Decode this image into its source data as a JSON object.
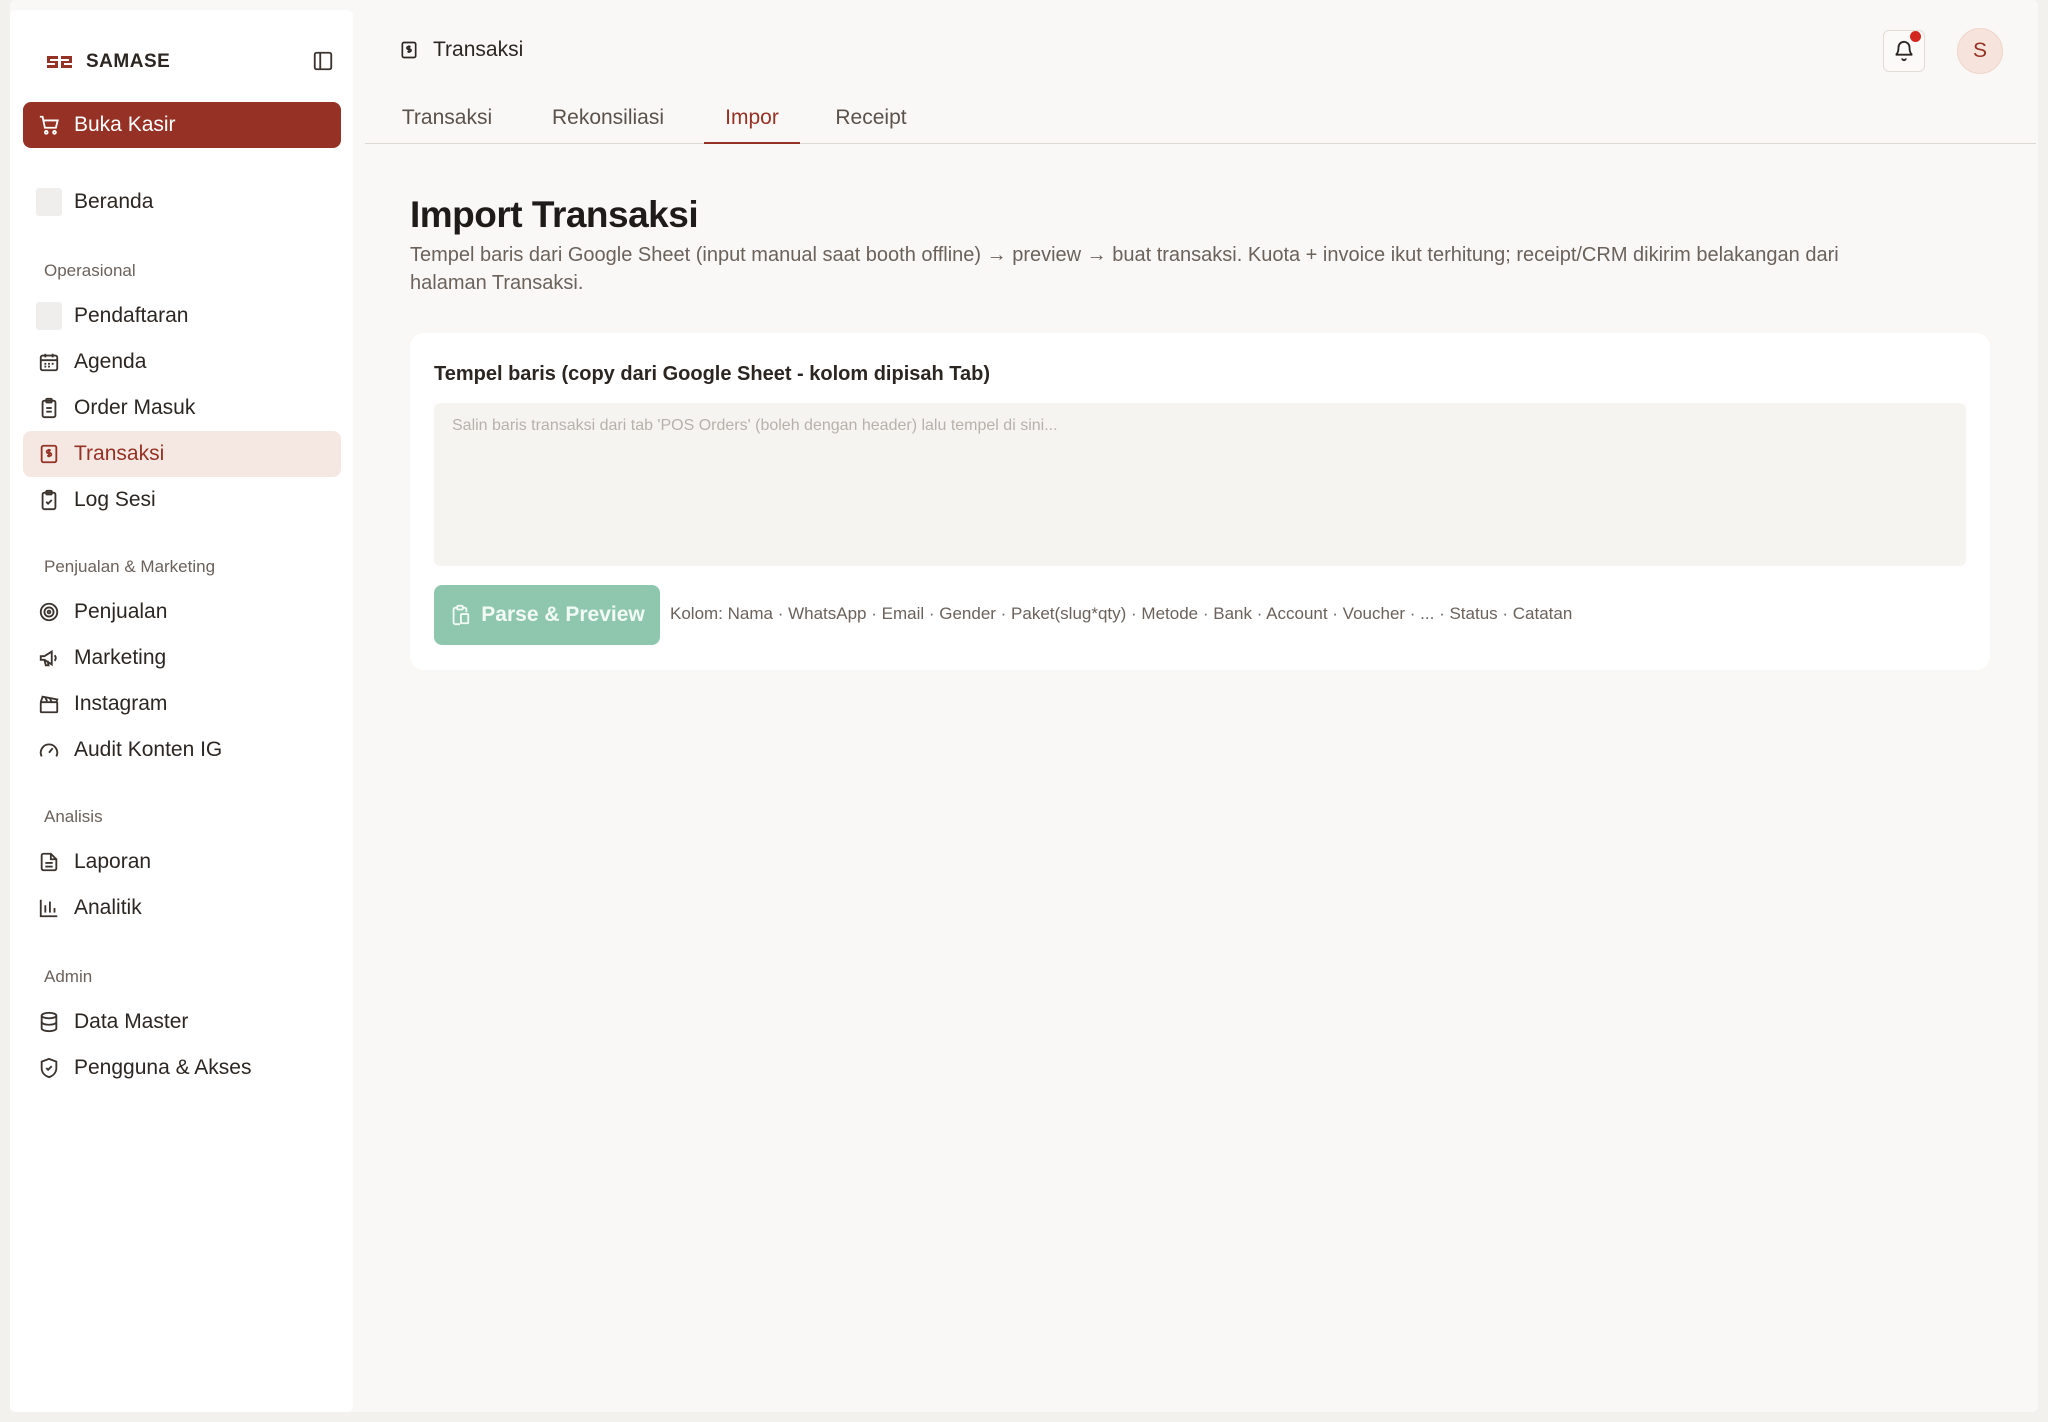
{
  "brand": {
    "name": "SAMASE"
  },
  "sidebar": {
    "cta_label": "Buka Kasir",
    "home_label": "Beranda",
    "sections": [
      {
        "label": "Operasional"
      },
      {
        "label": "Penjualan & Marketing"
      },
      {
        "label": "Analisis"
      },
      {
        "label": "Admin"
      }
    ],
    "items": [
      {
        "label": "Pendaftaran",
        "icon": "placeholder-icon"
      },
      {
        "label": "Agenda",
        "icon": "calendar-icon"
      },
      {
        "label": "Order Masuk",
        "icon": "clipboard-icon"
      },
      {
        "label": "Transaksi",
        "icon": "receipt-icon",
        "active": true
      },
      {
        "label": "Log Sesi",
        "icon": "clipboard-check-icon"
      },
      {
        "label": "Penjualan",
        "icon": "target-icon"
      },
      {
        "label": "Marketing",
        "icon": "megaphone-icon"
      },
      {
        "label": "Instagram",
        "icon": "clapperboard-icon"
      },
      {
        "label": "Audit Konten IG",
        "icon": "gauge-icon"
      },
      {
        "label": "Laporan",
        "icon": "file-text-icon"
      },
      {
        "label": "Analitik",
        "icon": "bar-chart-icon"
      },
      {
        "label": "Data Master",
        "icon": "database-icon"
      },
      {
        "label": "Pengguna & Akses",
        "icon": "shield-check-icon"
      }
    ]
  },
  "header": {
    "title": "Transaksi",
    "avatar_initial": "S"
  },
  "tabs": [
    {
      "label": "Transaksi"
    },
    {
      "label": "Rekonsiliasi"
    },
    {
      "label": "Impor",
      "active": true
    },
    {
      "label": "Receipt"
    }
  ],
  "page": {
    "title": "Import Transaksi",
    "description": "Tempel baris dari Google Sheet (input manual saat booth offline) → preview → buat transaksi. Kuota + invoice ikut terhitung; receipt/CRM dikirim belakangan dari halaman Transaksi."
  },
  "import_card": {
    "label": "Tempel baris (copy dari Google Sheet - kolom dipisah Tab)",
    "textarea_placeholder": "Salin baris transaksi dari tab 'POS Orders' (boleh dengan header) lalu tempel di sini...",
    "textarea_value": "",
    "button_label": "Parse & Preview",
    "columns_hint": "Kolom: Nama · WhatsApp · Email · Gender · Paket(slug*qty) · Metode · Bank · Account · Voucher · ... · Status · Catatan"
  },
  "colors": {
    "accent": "#953225",
    "accent_soft": "#f5e8e3",
    "button_disabled": "#8fc7ae",
    "notification": "#d3281f"
  }
}
